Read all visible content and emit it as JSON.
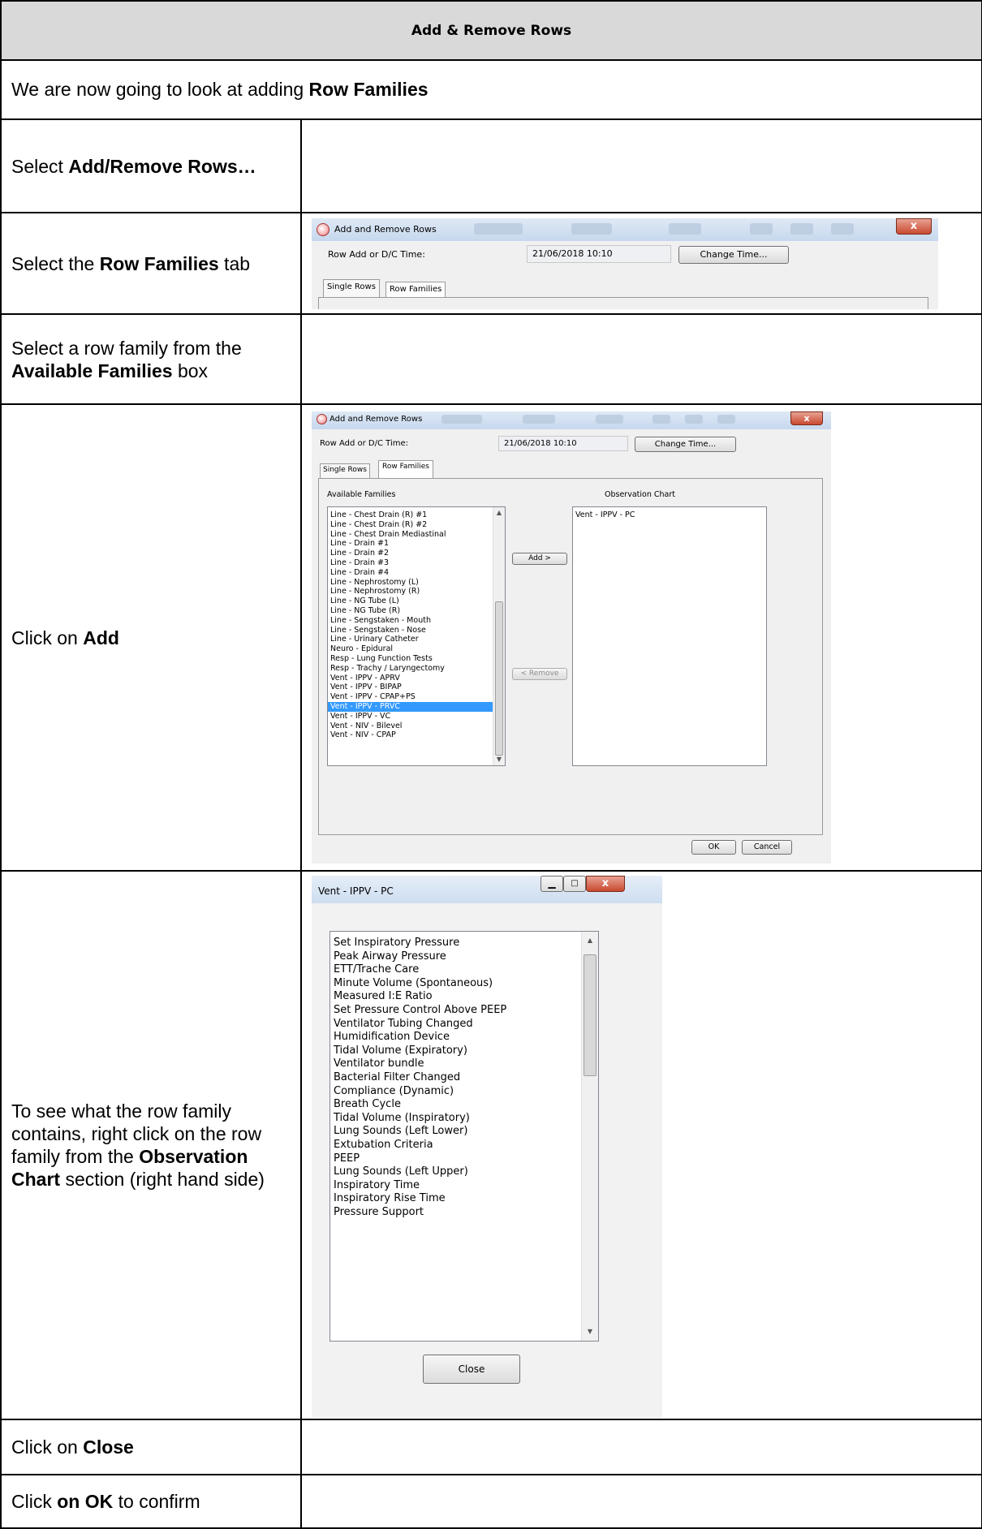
{
  "title": "Add & Remove Rows",
  "intro": {
    "text": "We are now going to look at adding ",
    "bold": "Row Families"
  },
  "steps": {
    "s1": {
      "pre": "Select ",
      "bold": "Add/Remove Rows…"
    },
    "s2": {
      "pre": "Select the ",
      "bold": "Row Families",
      "post": " tab"
    },
    "s3": {
      "pre": "Select a row family from the ",
      "bold": "Available Families",
      "post": " box"
    },
    "s4": {
      "pre": "Click on ",
      "bold": "Add"
    },
    "s5": {
      "pre": "To see what the row family contains, right click on the row family from the ",
      "bold": "Observation Chart",
      "post": " section (right hand side)"
    },
    "s6": {
      "pre": "Click on ",
      "bold": "Close"
    },
    "s7": {
      "pre": "Click ",
      "bold": "on OK",
      "post": " to confirm"
    }
  },
  "dialog": {
    "title": "Add and Remove Rows",
    "time_label": "Row Add or D/C Time:",
    "time_value": "21/06/2018 10:10",
    "change_time": "Change Time...",
    "tab_single": "Single Rows",
    "tab_families": "Row Families",
    "available_label": "Available Families",
    "observation_label": "Observation Chart",
    "add_button": "Add >",
    "remove_button": "< Remove",
    "ok_button": "OK",
    "cancel_button": "Cancel",
    "close_glyph": "x",
    "available_items": [
      "Line - Chest Drain (R) #1",
      "Line - Chest Drain (R) #2",
      "Line - Chest Drain Mediastinal",
      "Line - Drain #1",
      "Line - Drain #2",
      "Line - Drain #3",
      "Line - Drain #4",
      "Line - Nephrostomy (L)",
      "Line - Nephrostomy (R)",
      "Line - NG Tube (L)",
      "Line - NG Tube (R)",
      "Line - Sengstaken - Mouth",
      "Line - Sengstaken - Nose",
      "Line - Urinary Catheter",
      "Neuro - Epidural",
      "Resp - Lung Function Tests",
      "Resp - Trachy / Laryngectomy",
      "Vent - IPPV - APRV",
      "Vent - IPPV - BIPAP",
      "Vent - IPPV - CPAP+PS",
      "Vent - IPPV - PRVC",
      "Vent - IPPV - VC",
      "Vent - NIV - Bilevel",
      "Vent - NIV - CPAP"
    ],
    "selected_item": "Vent - IPPV - PRVC",
    "observation_items": [
      "Vent - IPPV - PC"
    ]
  },
  "family_window": {
    "title": "Vent - IPPV - PC",
    "close_button": "Close",
    "items": [
      "Set Inspiratory Pressure",
      "Peak Airway Pressure",
      "ETT/Trache Care",
      "Minute Volume (Spontaneous)",
      "Measured I:E Ratio",
      "Set Pressure Control Above PEEP",
      "Ventilator Tubing Changed",
      "Humidification Device",
      "Tidal Volume (Expiratory)",
      "Ventilator bundle",
      "Bacterial Filter Changed",
      "Compliance (Dynamic)",
      "Breath Cycle",
      "Tidal Volume (Inspiratory)",
      "Lung Sounds (Left Lower)",
      "Extubation Criteria",
      "PEEP",
      "Lung Sounds (Left Upper)",
      "Inspiratory Time",
      "Inspiratory Rise Time",
      "Pressure Support"
    ]
  }
}
